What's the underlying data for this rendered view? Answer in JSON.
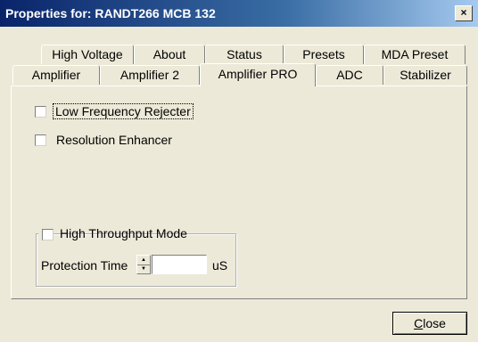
{
  "window": {
    "title": "Properties for: RANDT266 MCB 132",
    "close_glyph": "×"
  },
  "tabs_row1": [
    "High Voltage",
    "About",
    "Status",
    "Presets",
    "MDA Preset"
  ],
  "tabs_row2": [
    "Amplifier",
    "Amplifier 2",
    "Amplifier PRO",
    "ADC",
    "Stabilizer"
  ],
  "active_tab": "Amplifier PRO",
  "options": {
    "low_frequency_rejecter": {
      "label": "Low Frequency Rejecter",
      "checked": false
    },
    "resolution_enhancer": {
      "label": "Resolution Enhancer",
      "checked": false
    }
  },
  "group": {
    "legend": "High Throughput Mode",
    "checked": false,
    "protection_time_label": "Protection Time",
    "protection_time_value": "",
    "unit": "uS"
  },
  "buttons": {
    "close_first": "C",
    "close_rest": "lose"
  }
}
